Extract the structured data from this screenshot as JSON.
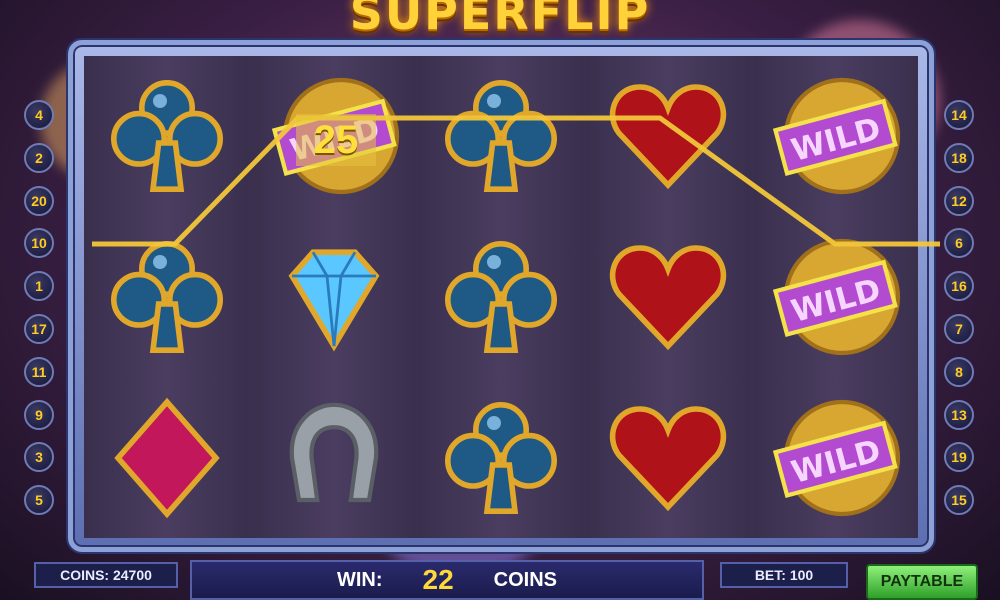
{
  "logo": {
    "text": "SUPERFLIP"
  },
  "paylines": {
    "left": [
      "4",
      "2",
      "20",
      "10",
      "1",
      "17",
      "11",
      "9",
      "3",
      "5"
    ],
    "right": [
      "14",
      "18",
      "12",
      "6",
      "16",
      "7",
      "8",
      "13",
      "19",
      "15"
    ]
  },
  "win_line_amount": "25",
  "reels": [
    [
      "club",
      "club",
      "diamond"
    ],
    [
      "wild",
      "gem",
      "horseshoe"
    ],
    [
      "club",
      "club",
      "club"
    ],
    [
      "heart",
      "heart",
      "heart"
    ],
    [
      "wild",
      "wild",
      "wild"
    ]
  ],
  "wild_text": "WILD",
  "status": {
    "coins_label": "COINS: 24700",
    "win_label": "WIN:",
    "win_value": "22",
    "win_unit": "COINS",
    "bet_label": "BET: 100"
  },
  "paytable_label": "PAYTABLE",
  "colors": {
    "payline": "#f2c63a",
    "club": "#1f5a86",
    "heart": "#b0121a",
    "diamond_suit": "#c2185b",
    "gem": "#5bc7ff",
    "wild": "#b34bd0"
  }
}
